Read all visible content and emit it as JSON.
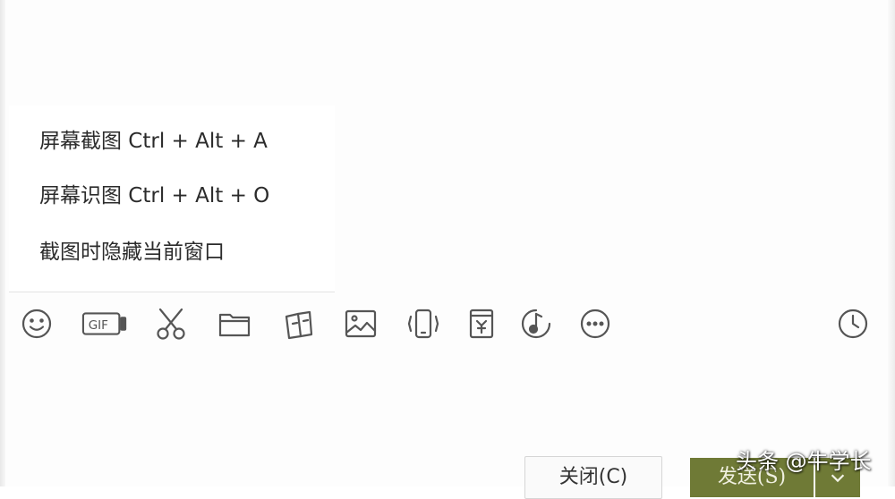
{
  "menu": {
    "items": [
      {
        "label": "屏幕截图 Ctrl + Alt + A"
      },
      {
        "label": "屏幕识图 Ctrl + Alt + O"
      },
      {
        "label": "截图时隐藏当前窗口"
      }
    ]
  },
  "toolbar": {
    "icons": [
      "emoji-icon",
      "gif-icon",
      "scissors-icon",
      "folder-icon",
      "sticker-icon",
      "image-icon",
      "shake-icon",
      "red-packet-icon",
      "music-icon",
      "more-icon",
      "history-clock-icon"
    ]
  },
  "actions": {
    "close_label": "关闭(C)",
    "send_label": "发送(S)"
  },
  "watermark": "头条 @牛学长",
  "colors": {
    "send_button": "#6f7a36",
    "icon_stroke": "#555555"
  }
}
